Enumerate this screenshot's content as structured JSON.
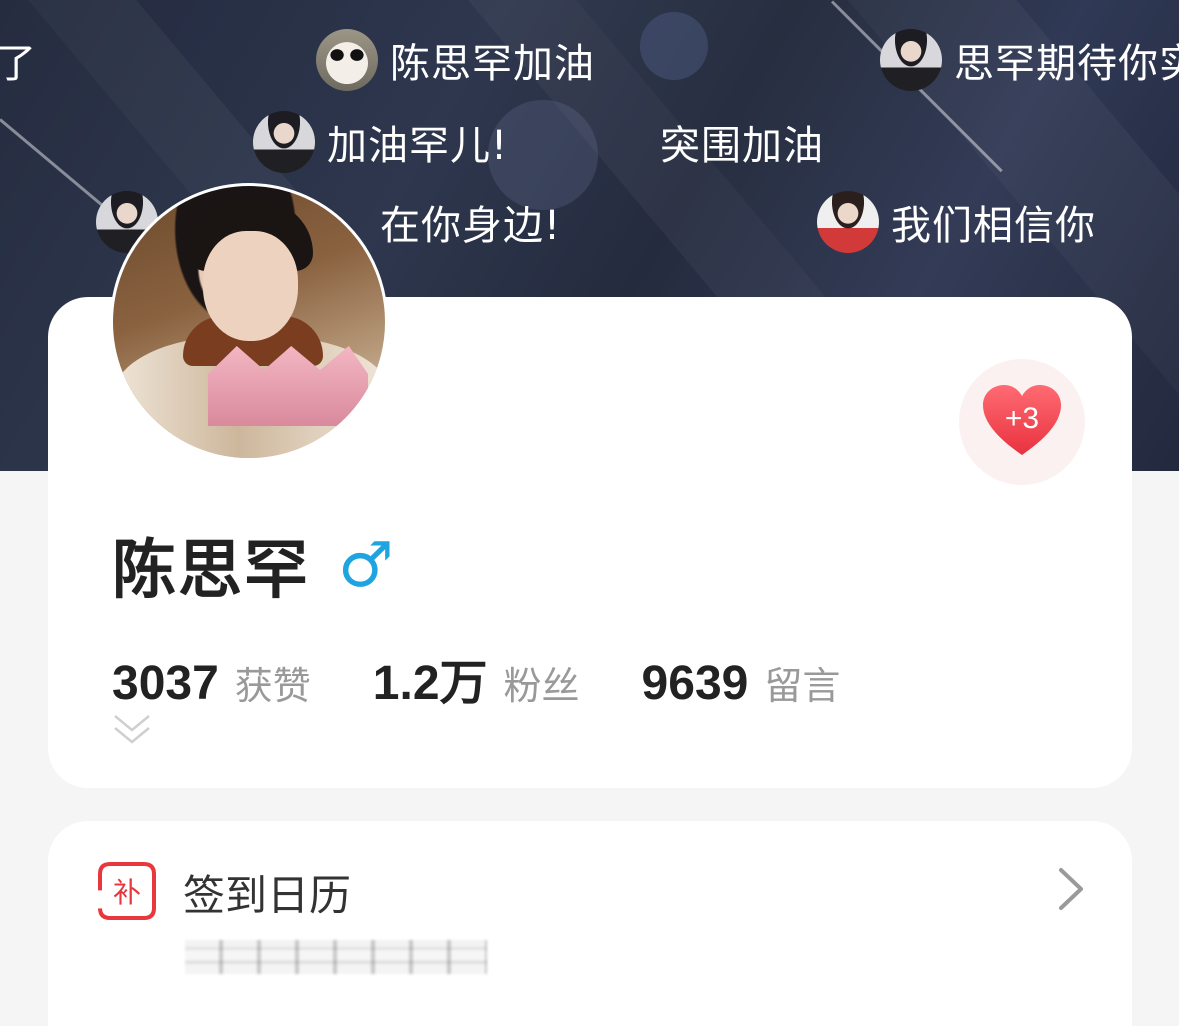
{
  "danmaku": [
    {
      "text": "了",
      "avatar": "none"
    },
    {
      "text": "陈思罕加油",
      "avatar": "cat-avatar"
    },
    {
      "text": "思罕期待你实",
      "avatar": "boy-avatar"
    },
    {
      "text": "加油罕儿!",
      "avatar": "boy-avatar"
    },
    {
      "text": "突围加油",
      "avatar": "none"
    },
    {
      "text": "在你身边!",
      "avatar": "boy-avatar"
    },
    {
      "text": "我们相信你",
      "avatar": "red-jersey-avatar"
    }
  ],
  "profile": {
    "name": "陈思罕",
    "gender_symbol": "♂",
    "like_count": "+3"
  },
  "stats": [
    {
      "value": "3037",
      "label": "获赞"
    },
    {
      "value": "1.2万",
      "label": "粉丝"
    },
    {
      "value": "9639",
      "label": "留言"
    }
  ],
  "checkin": {
    "icon_char": "补",
    "title": "签到日历"
  },
  "colors": {
    "accent_blue": "#1ea4e0",
    "like_red": "#f04a55",
    "checkin_red": "#e8383d"
  }
}
